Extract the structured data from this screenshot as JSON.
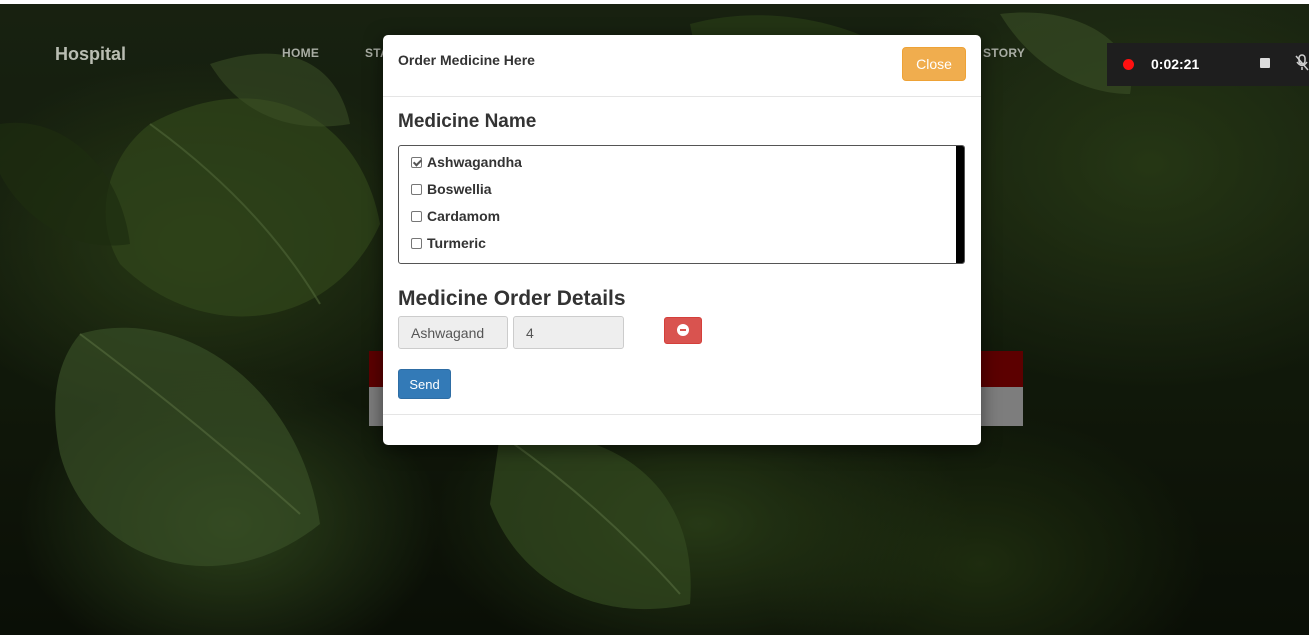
{
  "app": {
    "brand": "Hospital",
    "nav": [
      "HOME",
      "STA",
      "STORY"
    ]
  },
  "recorder": {
    "time": "0:02:21",
    "icons": [
      "record-dot",
      "stop-icon",
      "mic-muted-icon"
    ]
  },
  "modal": {
    "title": "Order Medicine Here",
    "close_label": "Close",
    "medicine_section_title": "Medicine Name",
    "medicines": [
      {
        "label": "Ashwagandha",
        "checked": true
      },
      {
        "label": "Boswellia",
        "checked": false
      },
      {
        "label": "Cardamom",
        "checked": false
      },
      {
        "label": "Turmeric",
        "checked": false
      }
    ],
    "order_section_title": "Medicine Order Details",
    "order_row": {
      "name": "Ashwagand",
      "quantity": "4"
    },
    "send_label": "Send"
  },
  "colors": {
    "close_button": "#f0ad4e",
    "send_button": "#337ab7",
    "remove_button": "#d9534f",
    "record_dot": "#ff1010"
  }
}
